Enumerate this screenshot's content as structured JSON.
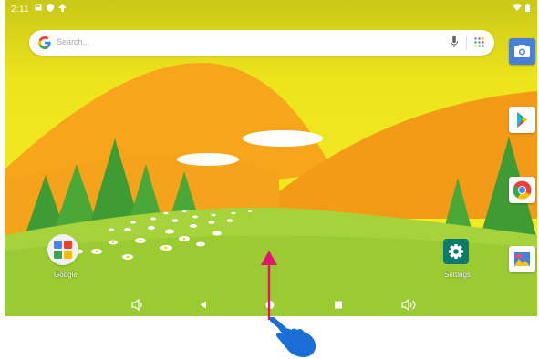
{
  "status_bar": {
    "time": "2:11"
  },
  "search": {
    "placeholder": "Search..."
  },
  "home_apps": [
    {
      "label": "Google"
    },
    {
      "label": "Settings"
    }
  ],
  "dock": [
    "camera-icon",
    "play-store-icon",
    "chrome-icon",
    "photos-icon"
  ],
  "nav_bar": [
    "volume-down-icon",
    "back-icon",
    "home-icon",
    "recents-icon",
    "volume-up-icon"
  ],
  "overlay": {
    "gesture": "swipe-up",
    "arrow_color": "#e0186c",
    "hand_color": "#1a6fd6"
  },
  "colors": {
    "sky": "#f2ec1e",
    "hills": "#f7a51a",
    "grass": "#9fd13a",
    "trees": "#4caf3c"
  }
}
